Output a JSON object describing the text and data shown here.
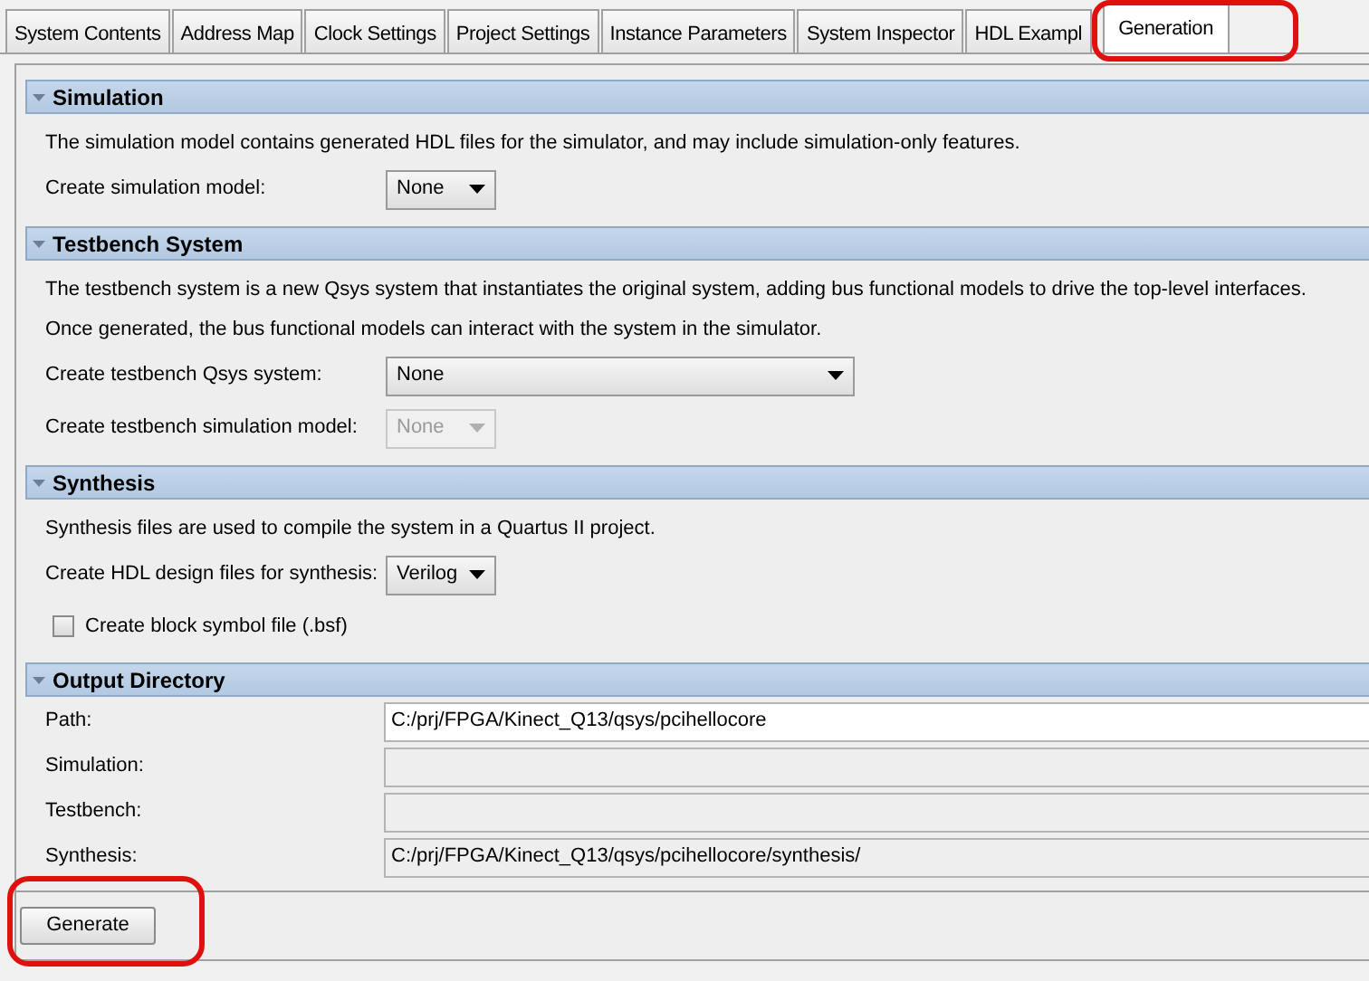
{
  "tabs": [
    {
      "label": "System Contents",
      "selected": false
    },
    {
      "label": "Address Map",
      "selected": false
    },
    {
      "label": "Clock Settings",
      "selected": false
    },
    {
      "label": "Project Settings",
      "selected": false
    },
    {
      "label": "Instance Parameters",
      "selected": false
    },
    {
      "label": "System Inspector",
      "selected": false
    },
    {
      "label": "HDL Exampl",
      "selected": false
    },
    {
      "label": "Generation",
      "selected": true
    }
  ],
  "sections": [
    {
      "title": "Simulation",
      "expanded": true,
      "rows": [
        {
          "kind": "text",
          "text": "The simulation model contains generated HDL files for the simulator, and may include simulation-only features."
        },
        {
          "kind": "dropdown",
          "label": "Create simulation model:",
          "value": "None",
          "disabled": false
        }
      ]
    },
    {
      "title": "Testbench System",
      "expanded": true,
      "rows": [
        {
          "kind": "text",
          "text": "The testbench system is a new Qsys system that instantiates the original system, adding bus functional models to drive the top-level interfaces."
        },
        {
          "kind": "text",
          "text": "Once generated, the bus functional models can interact with the system in the simulator."
        },
        {
          "kind": "wide_dropdown",
          "label": "Create testbench Qsys system:",
          "value": "None",
          "disabled": false
        },
        {
          "kind": "dropdown",
          "label": "Create testbench simulation model:",
          "value": "None",
          "disabled": true
        }
      ]
    },
    {
      "title": "Synthesis",
      "expanded": true,
      "rows": [
        {
          "kind": "text",
          "text": "Synthesis files are used to compile the system in a Quartus II project."
        },
        {
          "kind": "dropdown",
          "label": "Create HDL design files for synthesis:",
          "value": "Verilog",
          "disabled": false
        },
        {
          "kind": "checkbox",
          "label": "Create block symbol file (.bsf)",
          "checked": false
        }
      ]
    },
    {
      "title": "Output Directory",
      "expanded": true,
      "rows": [
        {
          "kind": "path",
          "label": "Path:",
          "value": "C:/prj/FPGA/Kinect_Q13/qsys/pcihellocore",
          "readonly": false
        },
        {
          "kind": "path",
          "label": "Simulation:",
          "readonly": true
        },
        {
          "kind": "path",
          "label": "Testbench:",
          "readonly": true
        },
        {
          "kind": "path",
          "label": "Synthesis:",
          "value": "C:/prj/FPGA/Kinect_Q13/qsys/pcihellocore/synthesis/",
          "readonly": true
        }
      ]
    }
  ],
  "generate_button": "Generate"
}
